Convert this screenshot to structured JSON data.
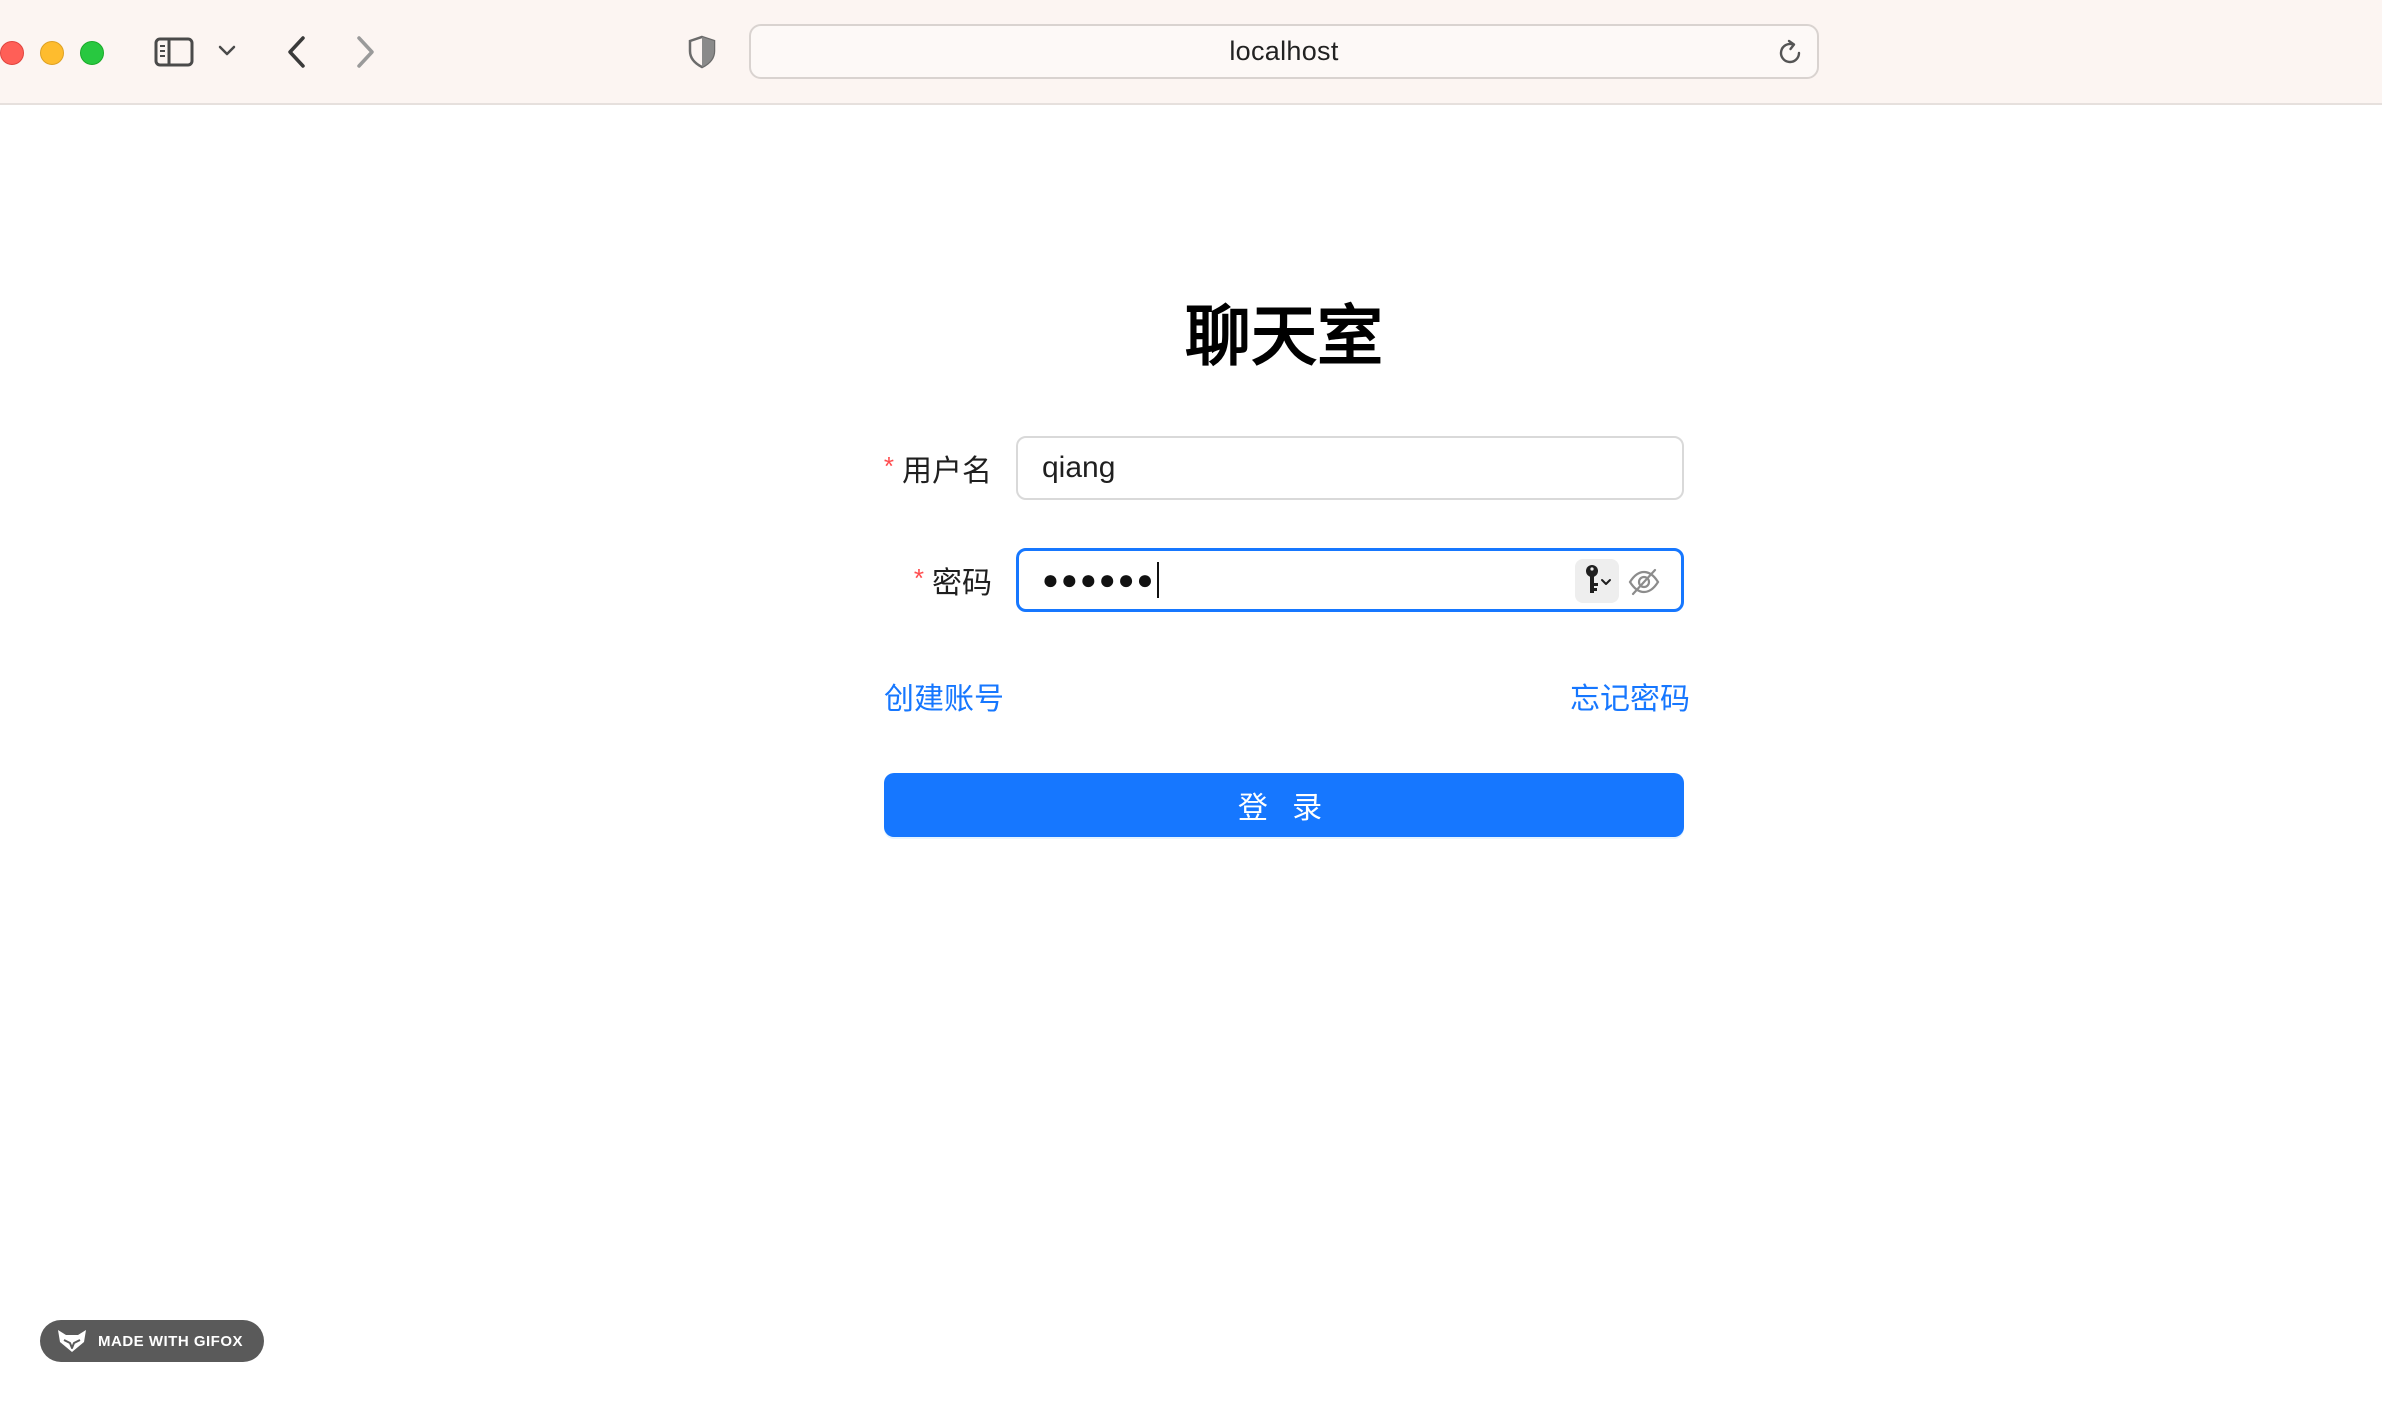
{
  "browser": {
    "url": "localhost",
    "icons": {
      "close": "close-window-icon",
      "minimize": "minimize-window-icon",
      "maximize": "maximize-window-icon",
      "sidebar": "sidebar-icon",
      "tab_menu": "chevron-down-icon",
      "back": "chevron-left-icon",
      "forward": "chevron-right-icon",
      "privacy": "shield-icon",
      "reload": "reload-icon"
    }
  },
  "login": {
    "title": "聊天室",
    "username_label": "用户名",
    "username_value": "qiang",
    "password_label": "密码",
    "password_masked": "●●●●●●",
    "required_mark": "*",
    "create_account": "创建账号",
    "forgot_password": "忘记密码",
    "submit_label": "登 录"
  },
  "watermark": {
    "text": "MADE WITH GIFOX"
  },
  "colors": {
    "primary": "#1677ff",
    "required": "#ff4d4f",
    "toolbar_bg": "#fcf5f2"
  }
}
